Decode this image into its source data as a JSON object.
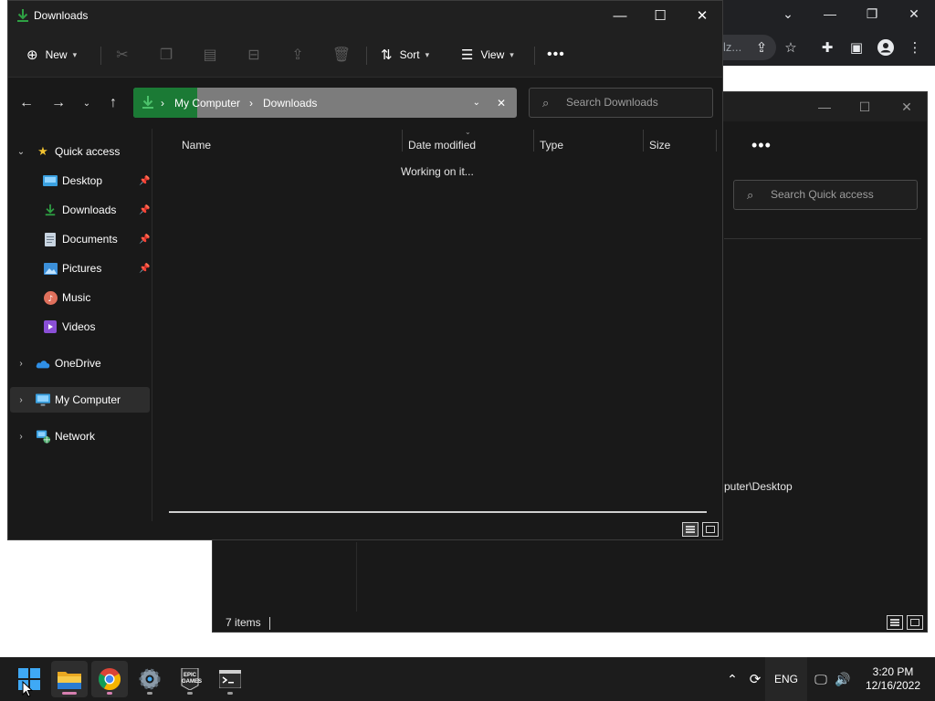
{
  "chrome": {
    "omnibox_tail": "lz...",
    "controls": {
      "tabs": "⌄",
      "minimize": "—",
      "restore": "❐",
      "close": "✕"
    }
  },
  "bg_explorer": {
    "search_placeholder": "Search Quick access",
    "more": "•••",
    "path_text": "puter\\Desktop",
    "status": "7 items"
  },
  "explorer": {
    "title": "Downloads",
    "commands": {
      "new": "New",
      "sort": "Sort",
      "view": "View",
      "more": "•••"
    },
    "address": {
      "segments": [
        "My Computer",
        "Downloads"
      ]
    },
    "search_placeholder": "Search Downloads",
    "sidebar": {
      "items": [
        {
          "label": "Quick access",
          "icon": "star-icon"
        },
        {
          "label": "Desktop",
          "icon": "desktop-icon",
          "pinned": true
        },
        {
          "label": "Downloads",
          "icon": "download-icon",
          "pinned": true
        },
        {
          "label": "Documents",
          "icon": "documents-icon",
          "pinned": true
        },
        {
          "label": "Pictures",
          "icon": "pictures-icon",
          "pinned": true
        },
        {
          "label": "Music",
          "icon": "music-icon"
        },
        {
          "label": "Videos",
          "icon": "videos-icon"
        },
        {
          "label": "OneDrive",
          "icon": "cloud-icon"
        },
        {
          "label": "My Computer",
          "icon": "computer-icon",
          "selected": true
        },
        {
          "label": "Network",
          "icon": "network-icon"
        }
      ]
    },
    "columns": [
      "Name",
      "Date modified",
      "Type",
      "Size"
    ],
    "loading_text": "Working on it..."
  },
  "taskbar": {
    "apps": [
      "start-icon",
      "file-explorer-icon",
      "chrome-icon",
      "settings-icon",
      "epic-games-icon",
      "terminal-icon"
    ],
    "epic_label": "EPIC GAMES",
    "tray": {
      "language": "ENG"
    },
    "clock": {
      "time": "3:20 PM",
      "date": "12/16/2022"
    }
  },
  "colors": {
    "window_bg": "#191919",
    "titlebar_bg": "#202020",
    "address_bg": "#7c7c7c",
    "address_progress": "#1b7a35",
    "accent_green": "#2ea043",
    "taskbar_bg": "#1c1c1c"
  }
}
